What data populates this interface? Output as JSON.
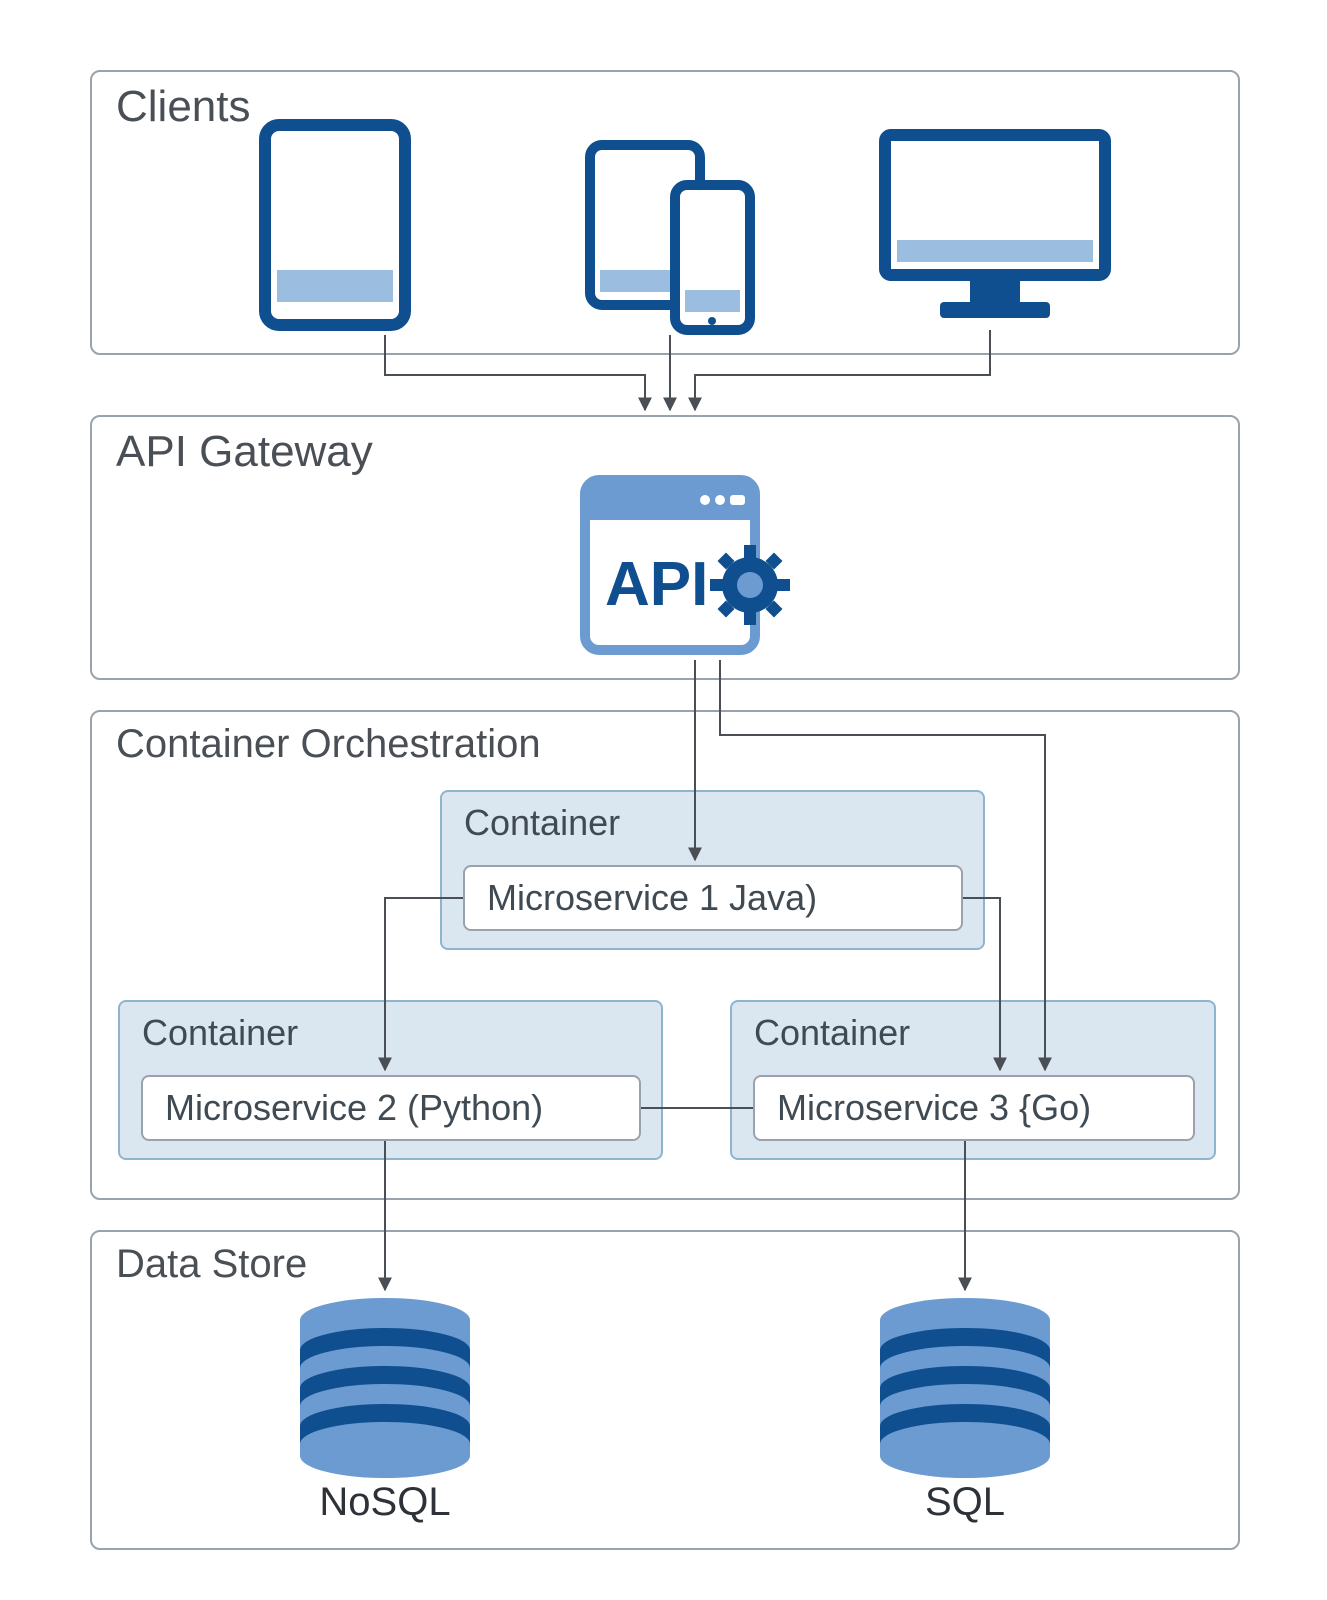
{
  "sections": {
    "clients": {
      "title": "Clients"
    },
    "api_gateway": {
      "title": "API Gateway",
      "api_label": "API"
    },
    "orchestration": {
      "title": "Container Orchestration",
      "container1": {
        "title": "Container",
        "service": "Microservice 1 Java)"
      },
      "container2": {
        "title": "Container",
        "service": "Microservice 2 (Python)"
      },
      "container3": {
        "title": "Container",
        "service": "Microservice 3 {Go)"
      }
    },
    "data_store": {
      "title": "Data Store",
      "nosql_label": "NoSQL",
      "sql_label": "SQL"
    }
  },
  "colors": {
    "blue_dark": "#0f4f8f",
    "blue_mid": "#6b9bd1",
    "blue_light": "#9bbde0",
    "section_border": "#9aa3ab",
    "container_bg": "#dbe7f0",
    "container_border": "#8fb4d0",
    "arrow": "#4a4f55"
  }
}
